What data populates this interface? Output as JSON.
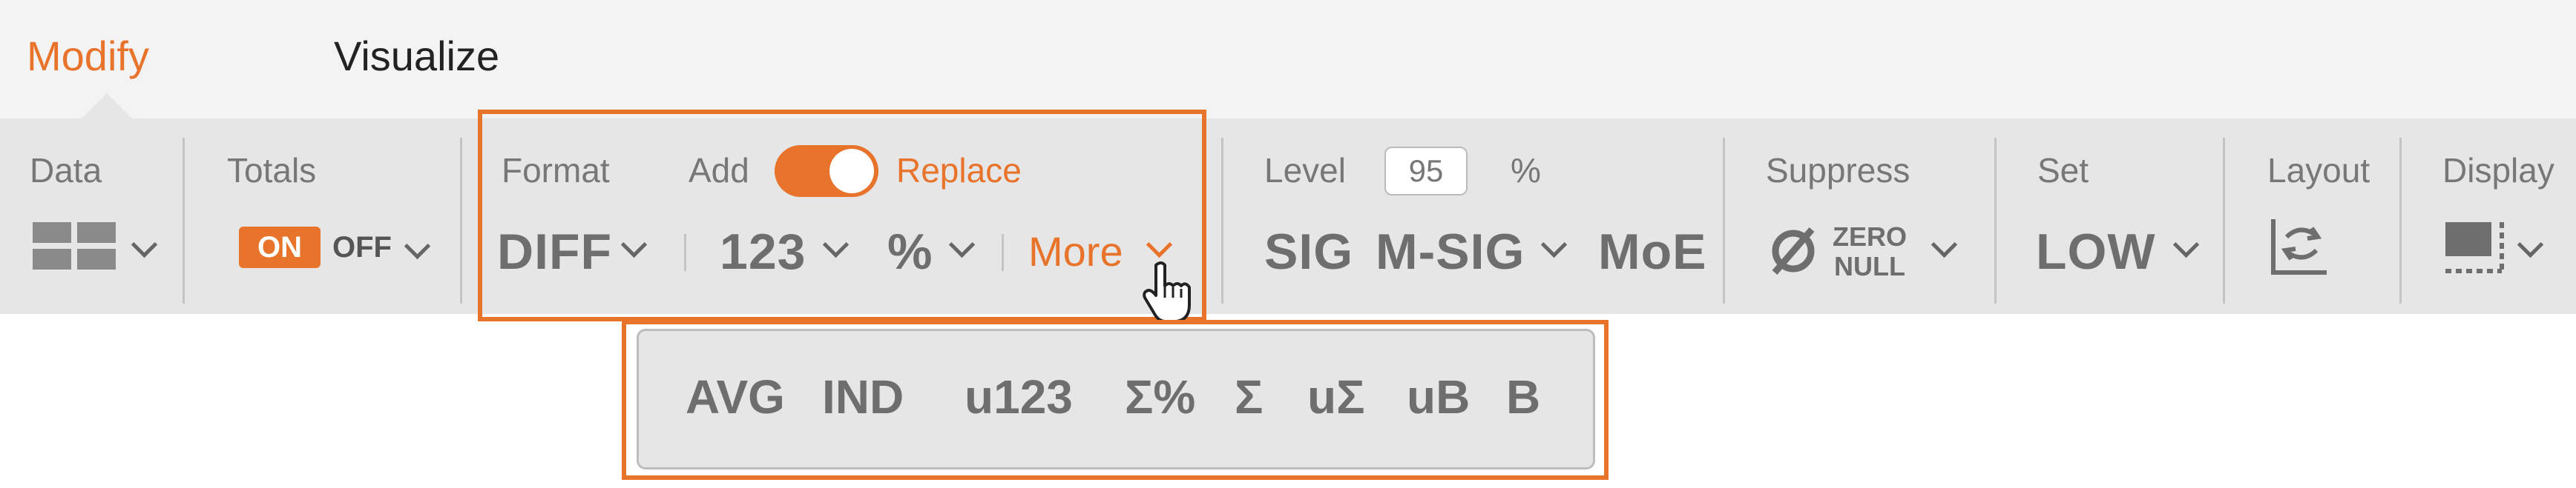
{
  "tabs": [
    {
      "label": "Modify",
      "active": true
    },
    {
      "label": "Visualize",
      "active": false
    }
  ],
  "groups": {
    "data": {
      "label": "Data"
    },
    "totals": {
      "label": "Totals",
      "on": "ON",
      "off": "OFF"
    },
    "format": {
      "label": "Format",
      "add": "Add",
      "replace": "Replace",
      "toggle_on": true,
      "diff": "DIFF",
      "num": "123",
      "pct": "%",
      "more": "More"
    },
    "level": {
      "label": "Level",
      "value": "95",
      "unit": "%",
      "sig": "SIG",
      "msig": "M-SIG",
      "moe": "MoE"
    },
    "suppress": {
      "label": "Suppress",
      "zero": "ZERO",
      "null": "NULL"
    },
    "set": {
      "label": "Set",
      "value": "LOW"
    },
    "layout": {
      "label": "Layout"
    },
    "display": {
      "label": "Display"
    }
  },
  "more_menu": [
    "AVG",
    "IND",
    "u123",
    "Σ%",
    "Σ",
    "uΣ",
    "uB",
    "B"
  ],
  "colors": {
    "accent": "#e8732a",
    "toolbar_bg": "#e6e6e6",
    "text": "#6e6e6e"
  }
}
